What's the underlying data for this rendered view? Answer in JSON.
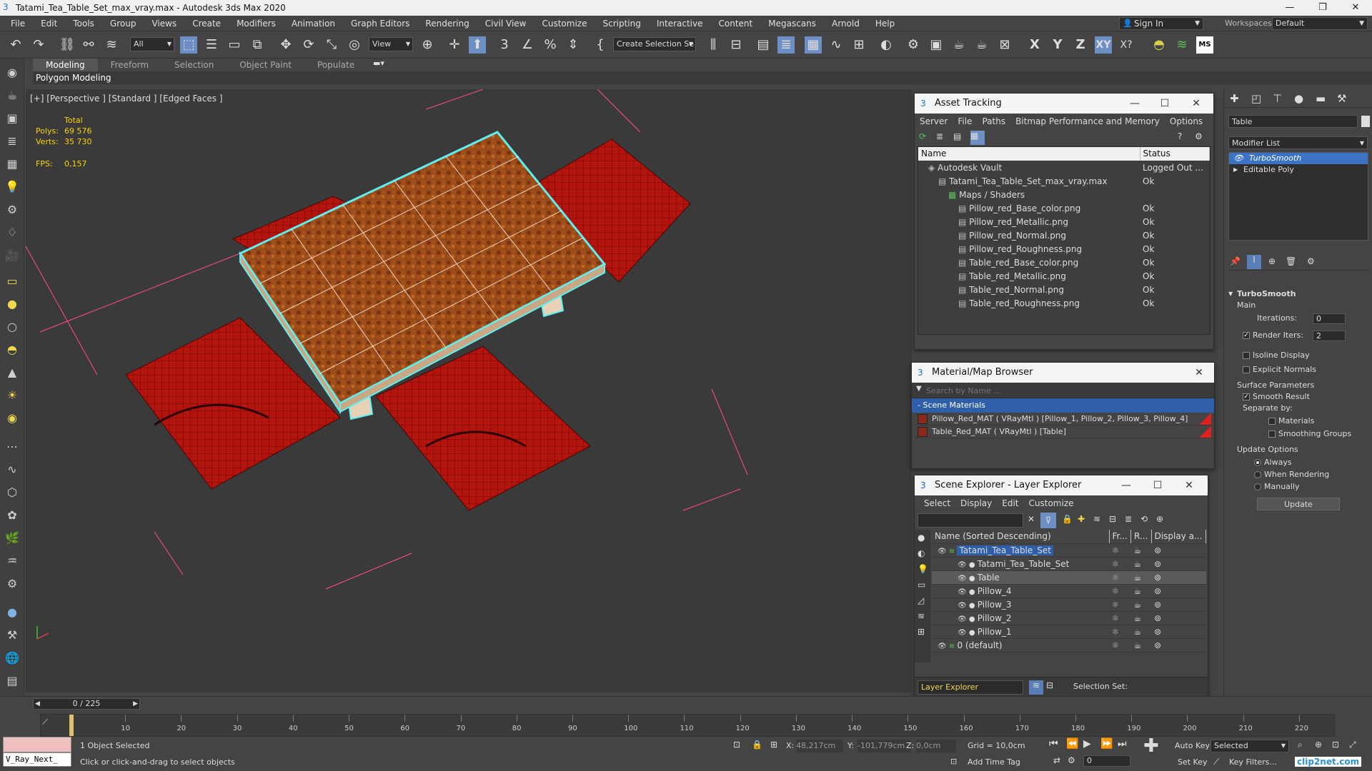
{
  "window": {
    "title": "Tatami_Tea_Table_Set_max_vray.max - Autodesk 3ds Max 2020"
  },
  "menus": [
    "File",
    "Edit",
    "Tools",
    "Group",
    "Views",
    "Create",
    "Modifiers",
    "Animation",
    "Graph Editors",
    "Rendering",
    "Civil View",
    "Customize",
    "Scripting",
    "Interactive",
    "Content",
    "Megascans",
    "Arnold",
    "Help"
  ],
  "account": {
    "sign_in": "Sign In",
    "workspaces_label": "Workspaces:",
    "workspace": "Default"
  },
  "toolbar": {
    "filter": "All",
    "view": "View",
    "selection_set": "Create Selection Se"
  },
  "ribbon": {
    "tabs": [
      "Modeling",
      "Freeform",
      "Selection",
      "Object Paint",
      "Populate"
    ],
    "subtab": "Polygon Modeling"
  },
  "viewport": {
    "label": "[+] [Perspective ] [Standard ] [Edged Faces ]",
    "stats_total": "Total",
    "polys_label": "Polys:",
    "polys": "69 576",
    "verts_label": "Verts:",
    "verts": "35 730",
    "fps_label": "FPS:",
    "fps": "0,157",
    "colors": {
      "pillow": "#b3140d",
      "table": "#a14f1a",
      "selection": "#5ef0f0",
      "grid_line": "#ff4d8a"
    }
  },
  "asset_tracking": {
    "title": "Asset Tracking",
    "menus": [
      "Server",
      "File",
      "Paths",
      "Bitmap Performance and Memory",
      "Options"
    ],
    "columns": [
      "Name",
      "Status"
    ],
    "rows": [
      {
        "indent": 1,
        "name": "Autodesk Vault",
        "status": "Logged Out ..."
      },
      {
        "indent": 2,
        "name": "Tatami_Tea_Table_Set_max_vray.max",
        "status": "Ok"
      },
      {
        "indent": 3,
        "name": "Maps / Shaders",
        "status": ""
      },
      {
        "indent": 4,
        "name": "Pillow_red_Base_color.png",
        "status": "Ok"
      },
      {
        "indent": 4,
        "name": "Pillow_red_Metallic.png",
        "status": "Ok"
      },
      {
        "indent": 4,
        "name": "Pillow_red_Normal.png",
        "status": "Ok"
      },
      {
        "indent": 4,
        "name": "Pillow_red_Roughness.png",
        "status": "Ok"
      },
      {
        "indent": 4,
        "name": "Table_red_Base_color.png",
        "status": "Ok"
      },
      {
        "indent": 4,
        "name": "Table_red_Metallic.png",
        "status": "Ok"
      },
      {
        "indent": 4,
        "name": "Table_red_Normal.png",
        "status": "Ok"
      },
      {
        "indent": 4,
        "name": "Table_red_Roughness.png",
        "status": "Ok"
      }
    ]
  },
  "material_browser": {
    "title": "Material/Map Browser",
    "search_placeholder": "Search by Name ...",
    "section": "- Scene Materials",
    "items": [
      "Pillow_Red_MAT ( VRayMtl ) [Pillow_1, Pillow_2, Pillow_3, Pillow_4]",
      "Table_Red_MAT ( VRayMtl ) [Table]"
    ]
  },
  "scene_explorer": {
    "title": "Scene Explorer - Layer Explorer",
    "menus": [
      "Select",
      "Display",
      "Edit",
      "Customize"
    ],
    "columns": [
      "Name (Sorted Descending)",
      "Fr...",
      "R...",
      "Display a..."
    ],
    "rows": [
      {
        "indent": 0,
        "name": "Tatami_Tea_Table_Set",
        "selected": false,
        "highlight": true
      },
      {
        "indent": 1,
        "name": "Tatami_Tea_Table_Set",
        "selected": false,
        "highlight": false
      },
      {
        "indent": 1,
        "name": "Table",
        "selected": true,
        "highlight": false
      },
      {
        "indent": 1,
        "name": "Pillow_4",
        "selected": false,
        "highlight": false
      },
      {
        "indent": 1,
        "name": "Pillow_3",
        "selected": false,
        "highlight": false
      },
      {
        "indent": 1,
        "name": "Pillow_2",
        "selected": false,
        "highlight": false
      },
      {
        "indent": 1,
        "name": "Pillow_1",
        "selected": false,
        "highlight": false
      },
      {
        "indent": 0,
        "name": "0 (default)",
        "selected": false,
        "highlight": false
      }
    ],
    "footer_explorer": "Layer Explorer",
    "selection_set_label": "Selection Set:"
  },
  "command_panel": {
    "object_name": "Table",
    "modifier_list": "Modifier List",
    "stack": [
      "TurboSmooth",
      "Editable Poly"
    ],
    "rollout": "TurboSmooth",
    "main": "Main",
    "iterations_label": "Iterations:",
    "iterations": "0",
    "render_iters_label": "Render Iters:",
    "render_iters": "2",
    "isoline": "Isoline Display",
    "explicit_normals": "Explicit Normals",
    "surface_params": "Surface Parameters",
    "smooth_result": "Smooth Result",
    "separate_by": "Separate by:",
    "materials": "Materials",
    "smoothing_groups": "Smoothing Groups",
    "update_options": "Update Options",
    "always": "Always",
    "when_rendering": "When Rendering",
    "manually": "Manually",
    "update_button": "Update"
  },
  "timeline": {
    "frame": "0 / 225",
    "ticks": [
      "10",
      "20",
      "30",
      "40",
      "50",
      "60",
      "70",
      "80",
      "90",
      "100",
      "110",
      "120",
      "130",
      "140",
      "150",
      "160",
      "170",
      "180",
      "190",
      "200",
      "210",
      "220"
    ],
    "current_frame": 0,
    "total_frames": 225
  },
  "status": {
    "script_field": "V_Ray_Next_",
    "selected": "1 Object Selected",
    "prompt": "Click or click-and-drag to select objects",
    "x_label": "X:",
    "x": "48,217cm",
    "y_label": "Y:",
    "y": "-101,779cm",
    "z_label": "Z:",
    "z": "0,0cm",
    "grid": "Grid = 10,0cm",
    "add_time_tag": "Add Time Tag",
    "auto_key": "Auto Key",
    "set_key": "Set Key",
    "selected_dropdown": "Selected",
    "key_filters": "Key Filters...",
    "frame_field": "0",
    "watermark": "clip2net.com"
  }
}
